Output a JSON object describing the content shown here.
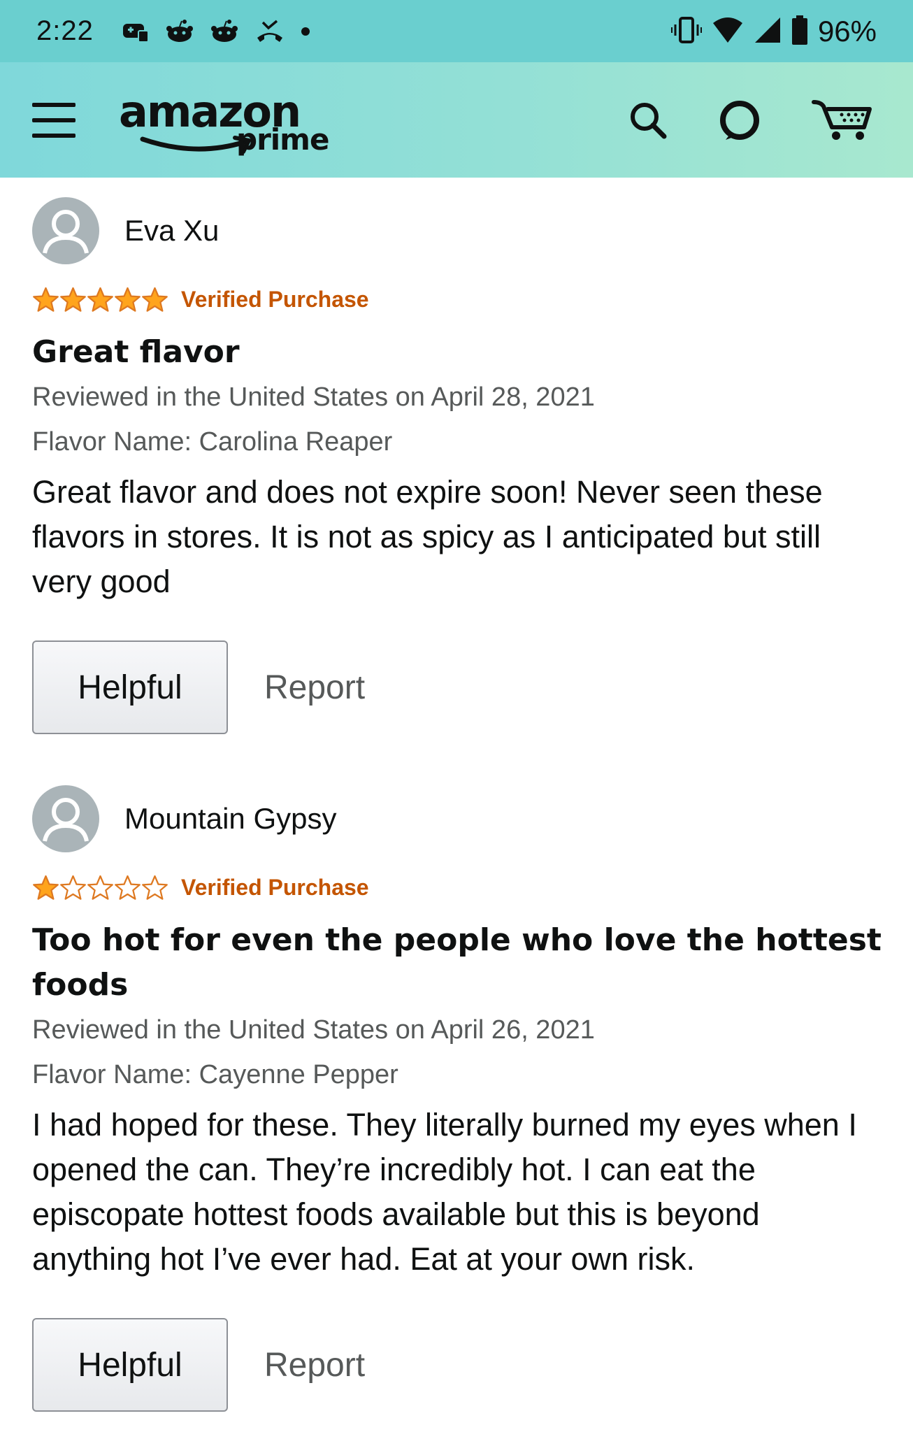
{
  "status_bar": {
    "time": "2:22",
    "battery_text": "96%",
    "notification_icons": [
      "gamepad-icon",
      "reddit-icon",
      "reddit-icon",
      "missed-call-icon",
      "dot-icon"
    ]
  },
  "header": {
    "logo_main": "amazon",
    "logo_sub": "prime",
    "icons": [
      "menu-icon",
      "search-icon",
      "alexa-icon",
      "cart-icon"
    ],
    "colors": {
      "bg_start": "#7fd8da",
      "bg_end": "#a8e8cf"
    }
  },
  "reviews": [
    {
      "name": "Eva Xu",
      "rating": 5,
      "rating_max": 5,
      "verified": "Verified Purchase",
      "title": "Great flavor",
      "meta": "Reviewed in the United States on April 28, 2021",
      "flavor": "Flavor Name: Carolina Reaper",
      "body": "Great flavor and does not expire soon! Never seen these flavors in stores. It is not as spicy as I anticipated but still very good",
      "helpful_label": "Helpful",
      "report_label": "Report"
    },
    {
      "name": "Mountain Gypsy",
      "rating": 1,
      "rating_max": 5,
      "verified": "Verified Purchase",
      "title": "Too hot for even the people who love the hottest foods",
      "meta": "Reviewed in the United States on April 26, 2021",
      "flavor": "Flavor Name: Cayenne Pepper",
      "body": "I had hoped for these. They literally burned my eyes when I opened the can. They’re incredibly hot. I can eat the episcopate hottest foods available but this is beyond anything hot I’ve ever had. Eat at your own risk.",
      "helpful_label": "Helpful",
      "report_label": "Report"
    }
  ],
  "colors": {
    "star": "#ffa41c",
    "verified": "#c45500",
    "meta": "#565959"
  }
}
